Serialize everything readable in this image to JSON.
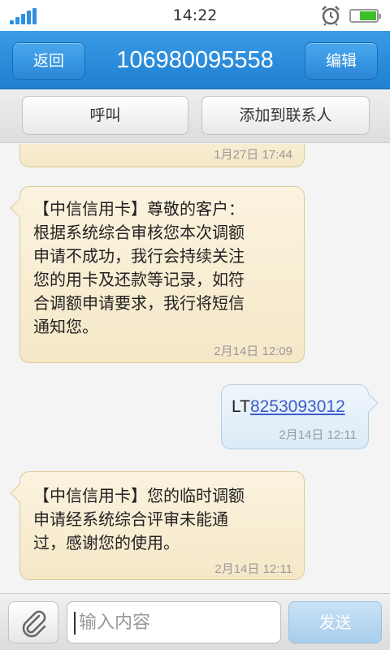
{
  "status_bar": {
    "time": "14:22"
  },
  "header": {
    "back_label": "返回",
    "title": "106980095558",
    "edit_label": "编辑"
  },
  "actions": {
    "call_label": "呼叫",
    "add_contact_label": "添加到联系人"
  },
  "messages": [
    {
      "direction": "in",
      "text": "",
      "time": "1月27日 17:44"
    },
    {
      "direction": "in",
      "text": "【中信信用卡】尊敬的客户：根据系统综合审核您本次调额申请不成功，我行会持续关注您的用卡及还款等记录，如符合调额申请要求，我行将短信通知您。",
      "lines": [
        "【中信信用卡】尊敬的客户：",
        "根据系统综合审核您本次调额",
        "申请不成功，我行会持续关注",
        "您的用卡及还款等记录，如符",
        "合调额申请要求，我行将短信",
        "通知您。"
      ],
      "time": "2月14日 12:09"
    },
    {
      "direction": "out",
      "prefix": "LT",
      "link": "8253093012",
      "time": "2月14日 12:11"
    },
    {
      "direction": "in",
      "text": "【中信信用卡】您的临时调额申请经系统综合评审未能通过，感谢您的使用。",
      "lines": [
        "【中信信用卡】您的临时调额",
        "申请经系统综合评审未能通",
        "过，感谢您的使用。"
      ],
      "time": "2月14日 12:11"
    }
  ],
  "composer": {
    "placeholder": "输入内容",
    "send_label": "发送"
  },
  "colors": {
    "accent": "#2a86d6",
    "incoming_bubble": "#f5e8c8",
    "outgoing_bubble": "#dcebf7",
    "link": "#3a5ccc"
  },
  "icons": {
    "signal": "signal-icon",
    "alarm": "alarm-clock-icon",
    "battery": "battery-icon",
    "attach": "paperclip-icon"
  }
}
